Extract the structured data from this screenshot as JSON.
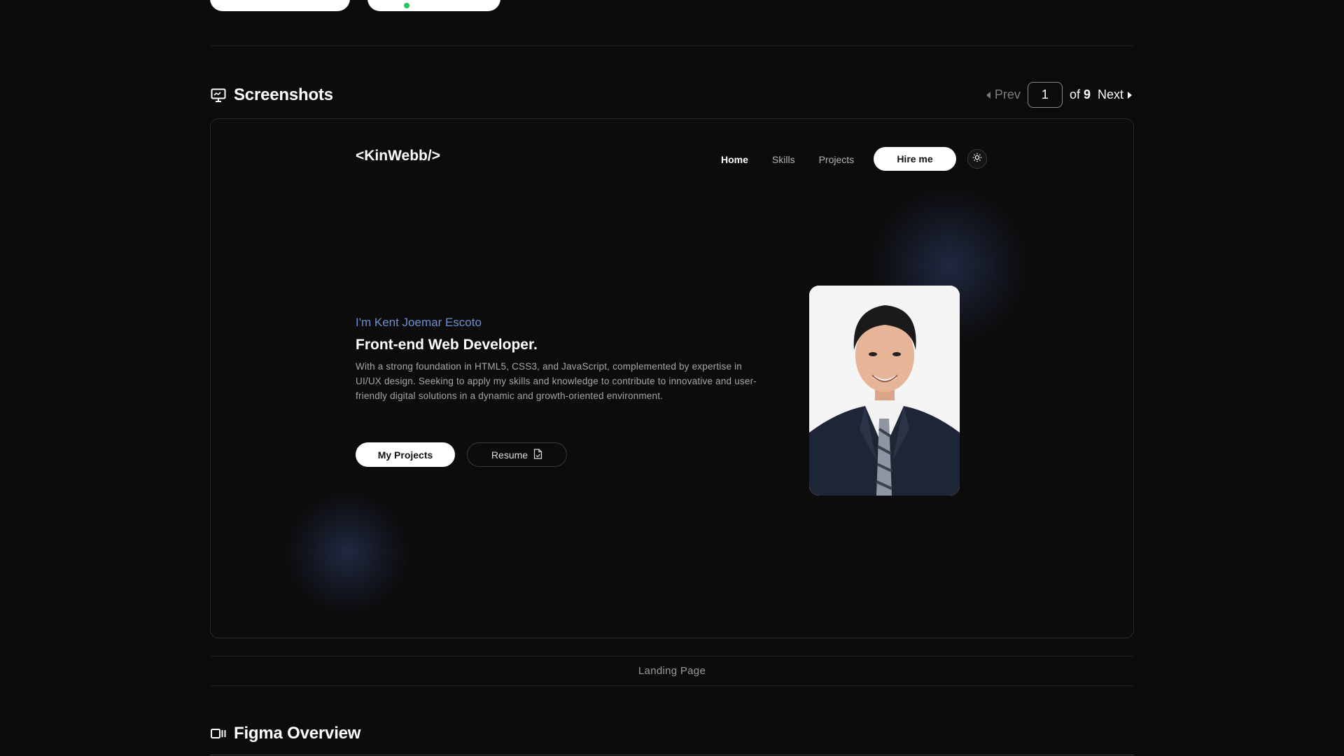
{
  "screenshots_section": {
    "title": "Screenshots",
    "icon": "monitor-icon"
  },
  "pagination": {
    "prev_label": "Prev",
    "current_page": "1",
    "of_label": "of",
    "total_pages": "9",
    "next_label": "Next"
  },
  "preview": {
    "logo": "<KinWebb/>",
    "nav": {
      "home": "Home",
      "skills": "Skills",
      "projects": "Projects",
      "hire_me": "Hire me",
      "theme_icon": "sun-icon"
    },
    "hero": {
      "intro": "I'm Kent Joemar Escoto",
      "role": "Front-end Web Developer.",
      "description": "With a strong foundation in HTML5, CSS3, and JavaScript, complemented by expertise in UI/UX design. Seeking to apply my skills and knowledge to contribute to innovative and user-friendly digital solutions in a dynamic and growth-oriented environment.",
      "projects_button": "My Projects",
      "resume_button": "Resume",
      "resume_icon": "document-icon"
    },
    "accent_color": "#6b8fcf"
  },
  "caption": "Landing Page",
  "figma_section": {
    "title": "Figma Overview",
    "icon": "figma-frame-icon"
  }
}
